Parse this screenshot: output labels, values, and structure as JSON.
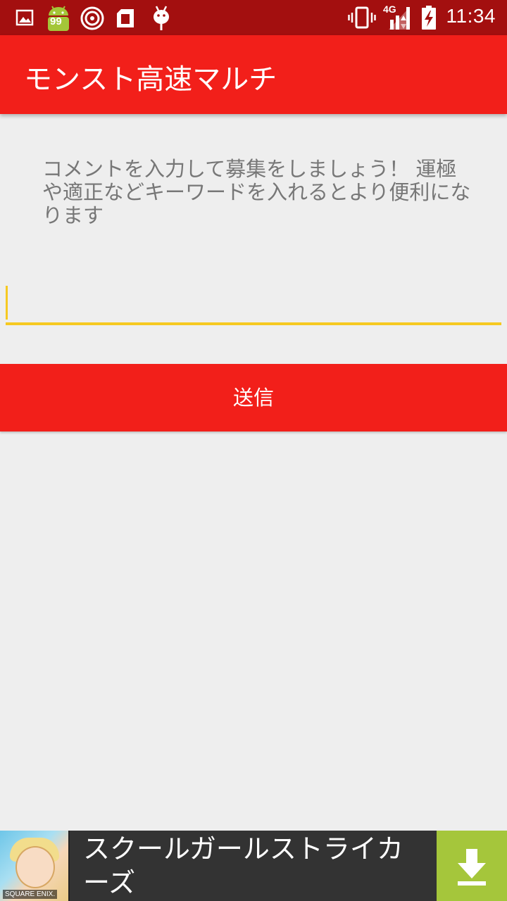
{
  "status_bar": {
    "time": "11:34",
    "notification_badge": "99",
    "network_type": "4G",
    "icons": [
      "image-icon",
      "android-99-icon",
      "hotspot-icon",
      "sim-card-icon",
      "bug-icon",
      "vibrate-icon",
      "signal-icon",
      "battery-charging-icon"
    ],
    "colors": {
      "background": "#a30f0f"
    }
  },
  "app_bar": {
    "title": "モンスト高速マルチ",
    "colors": {
      "background": "#f21f1a"
    }
  },
  "main": {
    "hint_text": "コメントを入力して募集をしましょう！ 運極や適正などキーワードを入れるとより便利になります",
    "comment_input": {
      "value": "",
      "accent_color": "#f6c921"
    },
    "send_button_label": "送信"
  },
  "ad_banner": {
    "title": "スクールガールストライカーズ",
    "thumbnail_brand": "SQUARE ENIX.",
    "download_icon": "download-icon",
    "colors": {
      "background": "#333333",
      "download": "#a5c63b"
    }
  }
}
